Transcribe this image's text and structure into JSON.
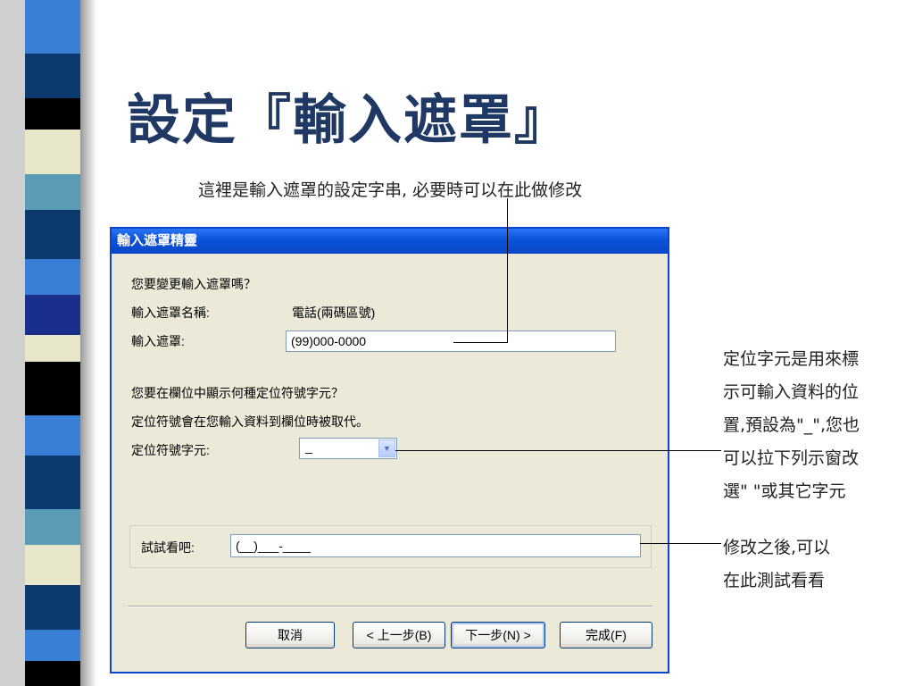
{
  "slide": {
    "title": "設定『輸入遮罩』",
    "annotation_top": "這裡是輸入遮罩的設定字串, 必要時可以在此做修改",
    "annotation_right": [
      "定位字元是用來標",
      "示可輸入資料的位",
      "置,預設為\"_\",您也",
      "可以拉下列示窗改",
      "選\" \"或其它字元"
    ],
    "annotation_bottom": [
      "修改之後,可以",
      "在此測試看看"
    ]
  },
  "dialog": {
    "title": "輸入遮罩精靈",
    "question1": "您要變更輸入遮罩嗎？",
    "mask_name_label": "輸入遮罩名稱:",
    "mask_name_value": "電話(兩碼區號)",
    "mask_label": "輸入遮罩:",
    "mask_value": "(99)000-0000",
    "question2": "您要在欄位中顯示何種定位符號字元？",
    "placeholder_note": "定位符號會在您輸入資料到欄位時被取代。",
    "placeholder_label": "定位符號字元:",
    "placeholder_value": "_",
    "try_label": "試試看吧:",
    "try_value": "(__)___-____",
    "buttons": {
      "cancel": "取消",
      "back": "< 上一步(B)",
      "next": "下一步(N) >",
      "finish": "完成(F)"
    }
  },
  "colors": {
    "title_text": "#1f3864",
    "titlebar": "#0a47c8",
    "dialog_bg": "#ece9d8",
    "stripe_dark": "#000000",
    "stripe_navy": "#0d3a6e",
    "stripe_blue": "#3a7fd6",
    "stripe_teal": "#5a9bb5",
    "stripe_cream": "#e8e6c8"
  }
}
